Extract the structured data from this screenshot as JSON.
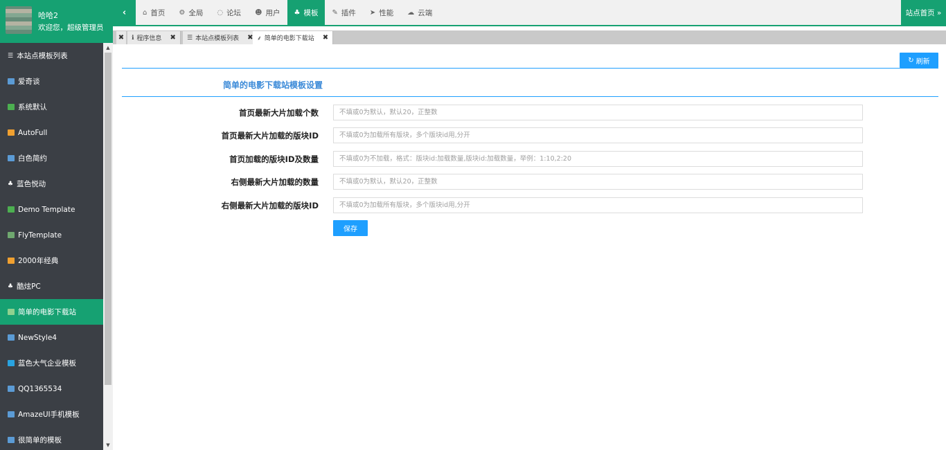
{
  "user": {
    "name": "哈哈2",
    "welcome": "欢迎您，超级管理员"
  },
  "nav": {
    "collapse_icon": "‹",
    "items": [
      {
        "label": "首页",
        "icon": "home-icon",
        "glyph": "⌂"
      },
      {
        "label": "全局",
        "icon": "cogs-icon",
        "glyph": "⚙"
      },
      {
        "label": "论坛",
        "icon": "comment-icon",
        "glyph": "◌"
      },
      {
        "label": "用户",
        "icon": "users-icon",
        "glyph": "☻"
      },
      {
        "label": "模板",
        "icon": "sitemap-icon",
        "glyph": "♣"
      },
      {
        "label": "插件",
        "icon": "plug-icon",
        "glyph": "✎"
      },
      {
        "label": "性能",
        "icon": "send-icon",
        "glyph": "➤"
      },
      {
        "label": "云端",
        "icon": "cloud-icon",
        "glyph": "☁"
      }
    ],
    "active_index": 4,
    "site_home": "站点首页 »"
  },
  "tabs": [
    {
      "label": "程序信息",
      "glyph": "ℹ"
    },
    {
      "label": "本站点模板列表",
      "glyph": "☰"
    },
    {
      "label": "简单的电影下载站",
      "glyph": "⸙"
    }
  ],
  "sidebar": {
    "items": [
      {
        "label": "本站点模板列表",
        "icon": "list-icon",
        "color": "#ffffff"
      },
      {
        "label": "爱奇谈",
        "icon": "template-thumb-icon",
        "color": "#5b9bd5"
      },
      {
        "label": "系统默认",
        "icon": "template-thumb-icon",
        "color": "#4caf50"
      },
      {
        "label": "AutoFull",
        "icon": "template-thumb-icon",
        "color": "#f0a030"
      },
      {
        "label": "白色简约",
        "icon": "template-thumb-icon",
        "color": "#5b9bd5"
      },
      {
        "label": "蓝色悦动",
        "icon": "sitemap-icon",
        "color": "#ffffff"
      },
      {
        "label": "Demo Template",
        "icon": "template-thumb-icon",
        "color": "#4caf50"
      },
      {
        "label": "FlyTemplate",
        "icon": "template-thumb-icon",
        "color": "#6fa86f"
      },
      {
        "label": "2000年经典",
        "icon": "template-thumb-icon",
        "color": "#f0a030"
      },
      {
        "label": "酷炫PC",
        "icon": "sitemap-icon",
        "color": "#ffffff"
      },
      {
        "label": "简单的电影下载站",
        "icon": "template-thumb-icon",
        "color": "#8fd18f"
      },
      {
        "label": "NewStyle4",
        "icon": "template-thumb-icon",
        "color": "#5b9bd5"
      },
      {
        "label": "蓝色大气企业模板",
        "icon": "template-thumb-icon",
        "color": "#29a3e0"
      },
      {
        "label": "QQ1365534",
        "icon": "template-thumb-icon",
        "color": "#5b9bd5"
      },
      {
        "label": "AmazeUI手机模板",
        "icon": "template-thumb-icon",
        "color": "#5b9bd5"
      },
      {
        "label": "很简单的模板",
        "icon": "template-thumb-icon",
        "color": "#5b9bd5"
      }
    ],
    "active_index": 10
  },
  "content": {
    "refresh_label": "刷新",
    "section_title": "简单的电影下载站模板设置",
    "fields": [
      {
        "label": "首页最新大片加载个数",
        "placeholder": "不填或0为默认，默认20，正整数",
        "value": ""
      },
      {
        "label": "首页最新大片加载的版块ID",
        "placeholder": "不填或0为加载所有版块，多个版块id用,分开",
        "value": ""
      },
      {
        "label": "首页加载的版块ID及数量",
        "placeholder": "不填或0为不加载，格式：版块id:加载数量,版块id:加载数量，举例：1:10,2:20",
        "value": ""
      },
      {
        "label": "右侧最新大片加载的数量",
        "placeholder": "不填或0为默认，默认20，正整数",
        "value": ""
      },
      {
        "label": "右侧最新大片加载的版块ID",
        "placeholder": "不填或0为加载所有版块，多个版块id用,分开",
        "value": ""
      }
    ],
    "save_label": "保存"
  },
  "colors": {
    "brand_green": "#16a172",
    "primary_blue": "#1e9fff",
    "sidebar_bg": "#3b3f45"
  }
}
